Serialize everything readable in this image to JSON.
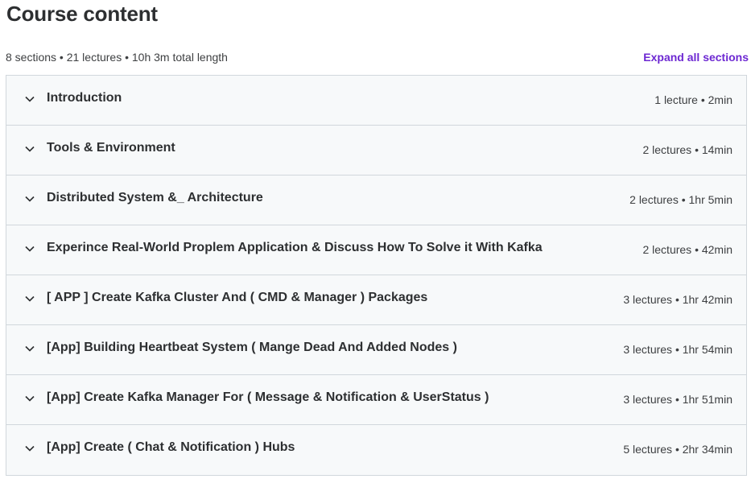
{
  "header": {
    "title": "Course content",
    "summary": "8 sections • 21 lectures • 10h 3m total length",
    "expand_label": "Expand all sections"
  },
  "colors": {
    "accent": "#6d28d2",
    "row_bg": "#f7f9fa",
    "border": "#d1d7dc",
    "text": "#2d2f31"
  },
  "sections": [
    {
      "title": "Introduction",
      "meta": "1 lecture • 2min",
      "icon": "chevron-down-icon"
    },
    {
      "title": "Tools & Environment",
      "meta": "2 lectures • 14min",
      "icon": "chevron-down-icon"
    },
    {
      "title": "Distributed System &_ Architecture",
      "meta": "2 lectures • 1hr 5min",
      "icon": "chevron-down-icon"
    },
    {
      "title": "Experince Real-World Proplem Application & Discuss How To Solve it With Kafka",
      "meta": "2 lectures • 42min",
      "icon": "chevron-down-icon"
    },
    {
      "title": "[ APP ] Create Kafka Cluster And ( CMD & Manager ) Packages",
      "meta": "3 lectures • 1hr 42min",
      "icon": "chevron-down-icon"
    },
    {
      "title": "[App] Building Heartbeat System ( Mange Dead And Added Nodes )",
      "meta": "3 lectures • 1hr 54min",
      "icon": "chevron-down-icon"
    },
    {
      "title": "[App] Create Kafka Manager For ( Message & Notification & UserStatus )",
      "meta": "3 lectures • 1hr 51min",
      "icon": "chevron-down-icon"
    },
    {
      "title": "[App] Create ( Chat & Notification ) Hubs",
      "meta": "5 lectures • 2hr 34min",
      "icon": "chevron-down-icon"
    }
  ]
}
